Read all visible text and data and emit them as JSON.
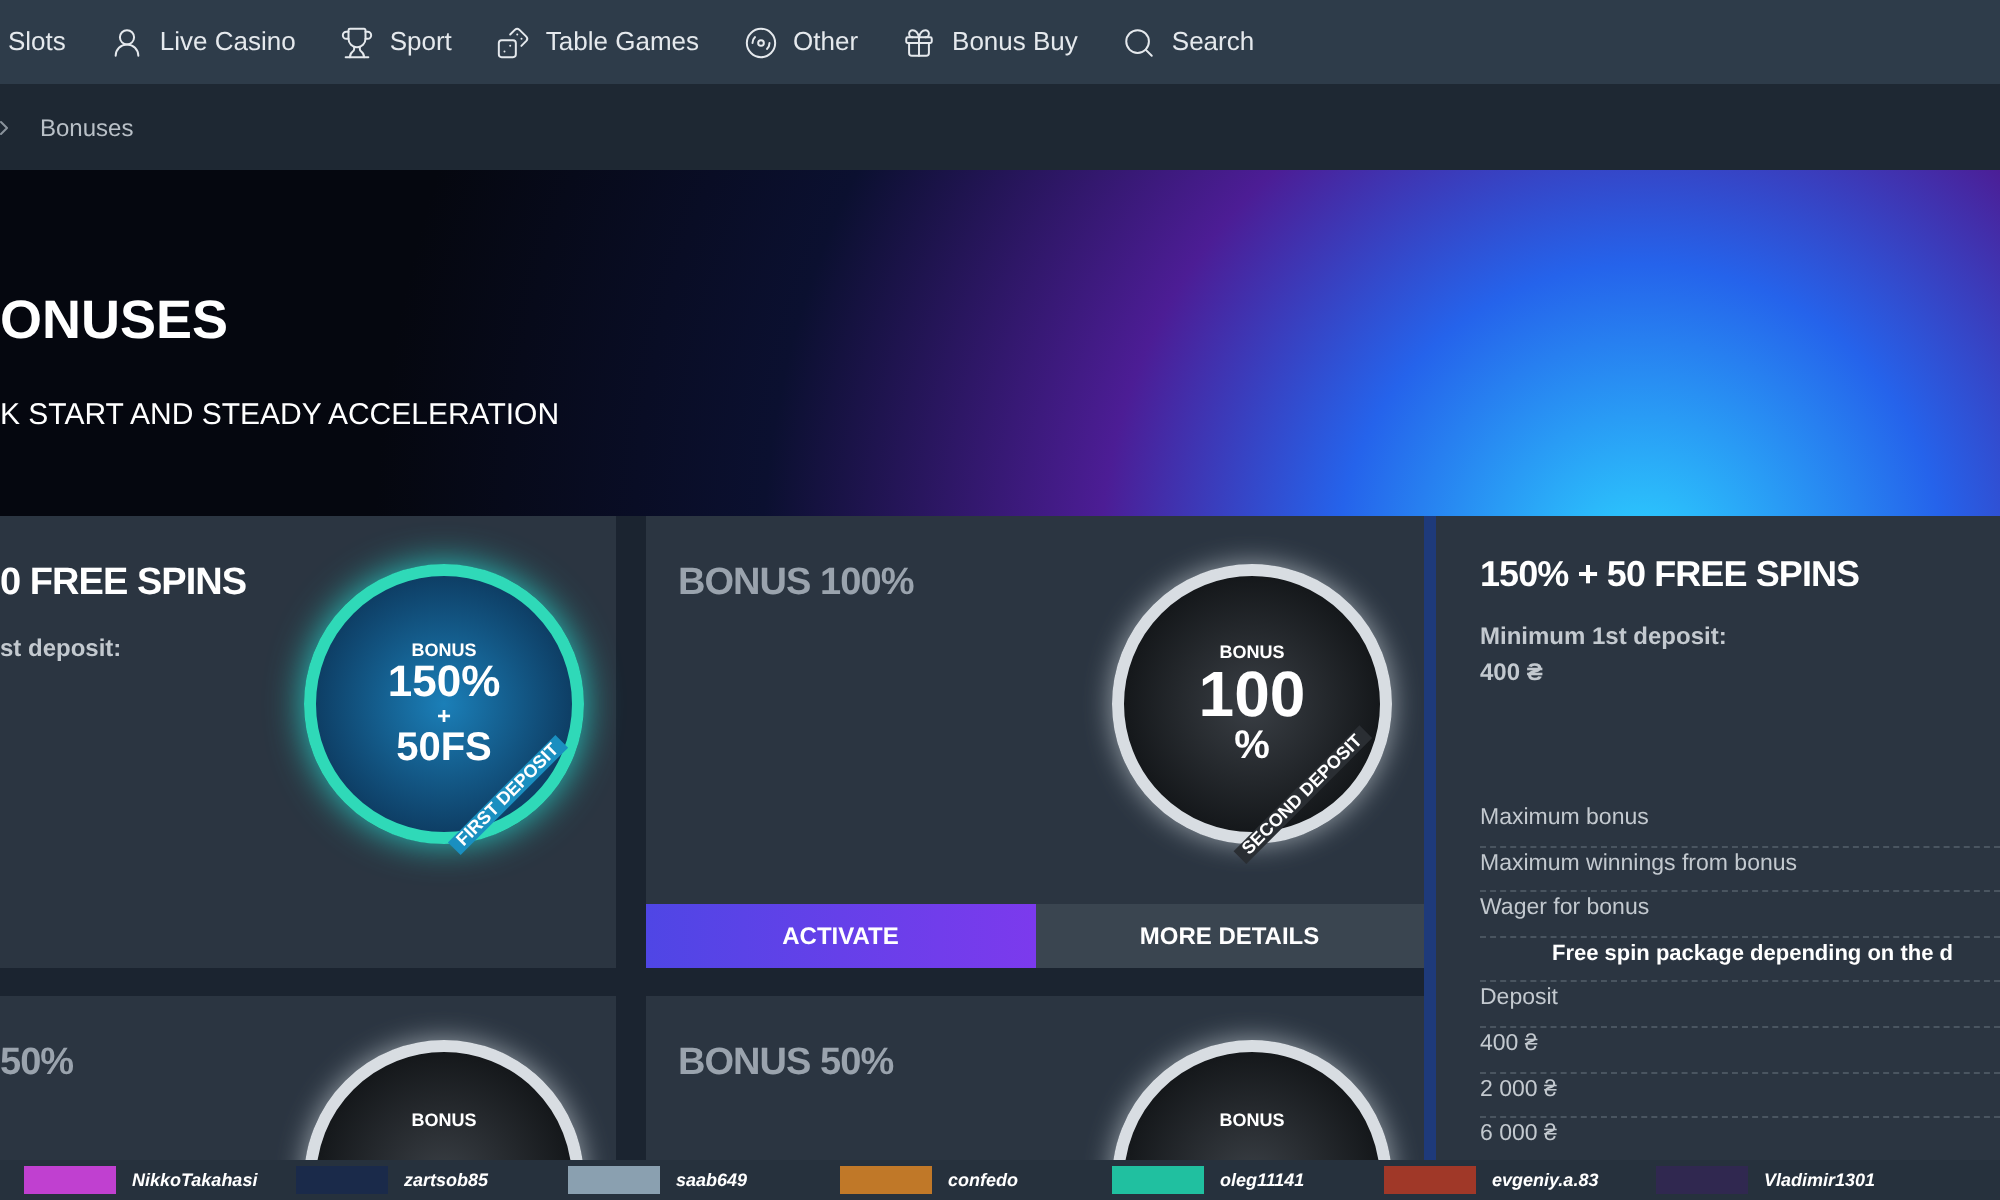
{
  "nav": [
    {
      "label": "Slots"
    },
    {
      "label": "Live Casino"
    },
    {
      "label": "Sport"
    },
    {
      "label": "Table Games"
    },
    {
      "label": "Other"
    },
    {
      "label": "Bonus Buy"
    },
    {
      "label": "Search"
    }
  ],
  "breadcrumb": "Bonuses",
  "hero": {
    "title": "ONUSES",
    "subtitle": "K START AND STEADY ACCELERATION"
  },
  "cards": [
    {
      "title": "0 FREE SPINS",
      "subtitle": "st deposit:",
      "badge": {
        "kind": "teal",
        "top": "BONUS",
        "main": "150%",
        "plus": "+",
        "second": "50FS",
        "ring": "FIRST DEPOSIT"
      }
    },
    {
      "title": "BONUS 100%",
      "badge": {
        "kind": "silver",
        "top": "BONUS",
        "main": "100",
        "second": "%",
        "ring": "SECOND DEPOSIT"
      },
      "buttons": [
        {
          "label": "ACTIVATE",
          "kind": "primary"
        },
        {
          "label": "MORE DETAILS",
          "kind": "secondary"
        }
      ]
    },
    {
      "title": "50%",
      "badge": {
        "kind": "silver",
        "top": "BONUS"
      }
    },
    {
      "title": "BONUS 50%",
      "badge": {
        "kind": "silver",
        "top": "BONUS"
      }
    }
  ],
  "details": {
    "title": "150% + 50 FREE SPINS",
    "min_label": "Minimum 1st deposit:",
    "min_value": "400 ₴",
    "rows": [
      {
        "kind": "row",
        "label": "Maximum bonus"
      },
      {
        "kind": "row",
        "label": "Maximum winnings from bonus"
      },
      {
        "kind": "row",
        "label": "Wager for bonus"
      },
      {
        "kind": "heading",
        "label": "Free spin package depending on the d"
      },
      {
        "kind": "row",
        "label": "Deposit"
      },
      {
        "kind": "row",
        "label": "400 ₴"
      },
      {
        "kind": "row",
        "label": "2 000 ₴"
      },
      {
        "kind": "row",
        "label": "6 000 ₴"
      }
    ]
  },
  "ticker": [
    {
      "name": "NikkoTakahasi",
      "color": "#c040d0"
    },
    {
      "name": "zartsob85",
      "color": "#1a2a4a"
    },
    {
      "name": "saab649",
      "color": "#8aa0b0"
    },
    {
      "name": "confedo",
      "color": "#c07828"
    },
    {
      "name": "oleg11141",
      "color": "#20c0a0"
    },
    {
      "name": "evgeniy.a.83",
      "color": "#a03828"
    },
    {
      "name": "Vladimir1301",
      "color": "#302850"
    }
  ]
}
